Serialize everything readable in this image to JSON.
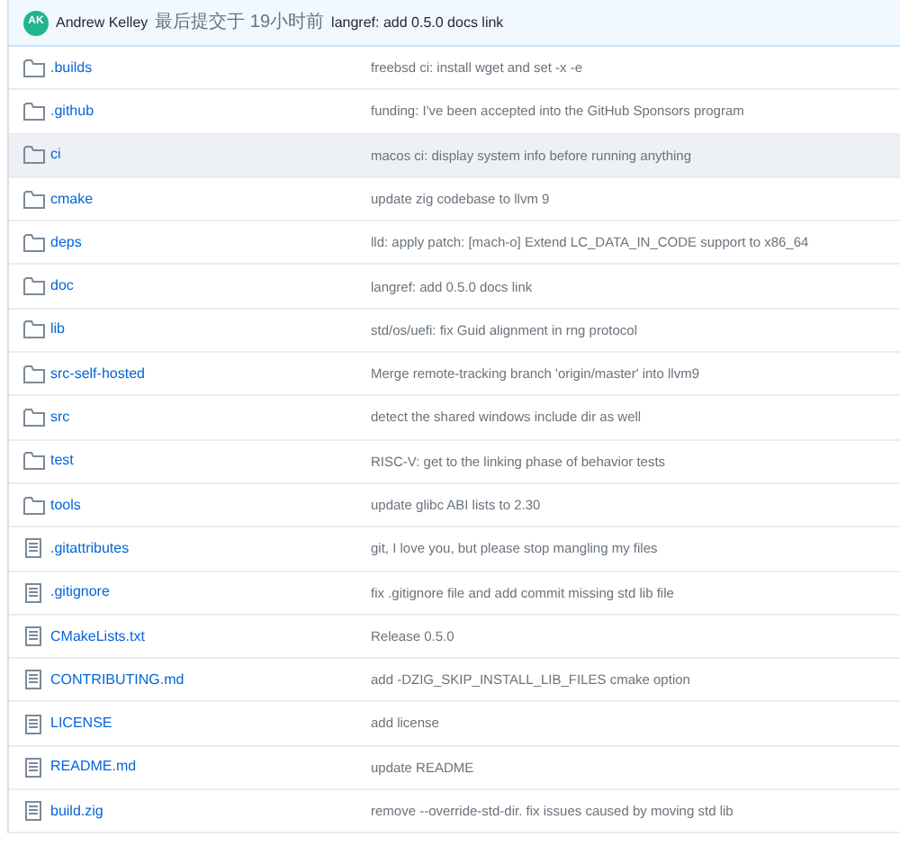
{
  "commit": {
    "avatar": "AK",
    "author": "Andrew Kelley",
    "when": "最后提交于 19小时前",
    "message": "langref: add 0.5.0 docs link"
  },
  "files": [
    {
      "kind": "folder",
      "name": ".builds",
      "message": "freebsd ci: install wget and set -x -e",
      "highlighted": false
    },
    {
      "kind": "folder",
      "name": ".github",
      "message": "funding: I've been accepted into the GitHub Sponsors program",
      "highlighted": false
    },
    {
      "kind": "folder",
      "name": "ci",
      "message": "macos ci: display system info before running anything",
      "highlighted": true
    },
    {
      "kind": "folder",
      "name": "cmake",
      "message": "update zig codebase to llvm 9",
      "highlighted": false
    },
    {
      "kind": "folder",
      "name": "deps",
      "message": "lld: apply patch: [mach-o] Extend LC_DATA_IN_CODE support to x86_64",
      "highlighted": false
    },
    {
      "kind": "folder",
      "name": "doc",
      "message": "langref: add 0.5.0 docs link",
      "highlighted": false
    },
    {
      "kind": "folder",
      "name": "lib",
      "message": "std/os/uefi: fix Guid alignment in rng protocol",
      "highlighted": false
    },
    {
      "kind": "folder",
      "name": "src-self-hosted",
      "message": "Merge remote-tracking branch 'origin/master' into llvm9",
      "highlighted": false
    },
    {
      "kind": "folder",
      "name": "src",
      "message": "detect the shared windows include dir as well",
      "highlighted": false
    },
    {
      "kind": "folder",
      "name": "test",
      "message": "RISC-V: get to the linking phase of behavior tests",
      "highlighted": false
    },
    {
      "kind": "folder",
      "name": "tools",
      "message": "update glibc ABI lists to 2.30",
      "highlighted": false
    },
    {
      "kind": "file",
      "name": ".gitattributes",
      "message": "git, I love you, but please stop mangling my files",
      "highlighted": false
    },
    {
      "kind": "file",
      "name": ".gitignore",
      "message": "fix .gitignore file and add commit missing std lib file",
      "highlighted": false
    },
    {
      "kind": "file",
      "name": "CMakeLists.txt",
      "message": "Release 0.5.0",
      "highlighted": false
    },
    {
      "kind": "file",
      "name": "CONTRIBUTING.md",
      "message": "add -DZIG_SKIP_INSTALL_LIB_FILES cmake option",
      "highlighted": false
    },
    {
      "kind": "file",
      "name": "LICENSE",
      "message": "add license",
      "highlighted": false
    },
    {
      "kind": "file",
      "name": "README.md",
      "message": "update README",
      "highlighted": false
    },
    {
      "kind": "file",
      "name": "build.zig",
      "message": "remove --override-std-dir. fix issues caused by moving std lib",
      "highlighted": false
    }
  ]
}
